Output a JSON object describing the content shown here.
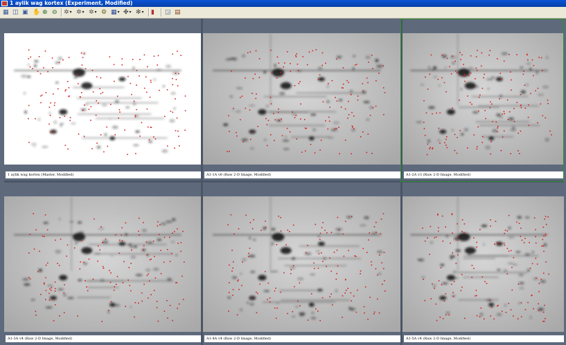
{
  "window": {
    "title": "1 aylik wag kortex (Experiment, Modified)"
  },
  "toolbar": {
    "buttons": [
      {
        "name": "grid-view-icon",
        "glyph": "▦"
      },
      {
        "name": "tile-view-icon",
        "glyph": "◫"
      },
      {
        "name": "image-view-icon",
        "glyph": "▣"
      },
      {
        "name": "pan-hand-icon",
        "glyph": "✋"
      },
      {
        "name": "zoom-in-icon",
        "glyph": "⊕"
      },
      {
        "name": "zoom-out-icon",
        "glyph": "⊖"
      },
      {
        "name": "spot-tool-icon",
        "glyph": "✲"
      },
      {
        "name": "spot-edit-icon",
        "glyph": "✲"
      },
      {
        "name": "spot-filter-icon",
        "glyph": "✲"
      },
      {
        "name": "match-tool-icon",
        "glyph": "⚙"
      },
      {
        "name": "grid-tool-icon",
        "glyph": "▦"
      },
      {
        "name": "landmark-tool-icon",
        "glyph": "✤"
      },
      {
        "name": "pattern-tool-icon",
        "glyph": "✻"
      },
      {
        "name": "color-bars-icon",
        "glyph": "▮"
      },
      {
        "name": "chart-icon",
        "glyph": "◲"
      },
      {
        "name": "properties-icon",
        "glyph": "▤"
      }
    ]
  },
  "panes": [
    {
      "label": "1 aylik wag kortex (Master, Modified)",
      "type": "master"
    },
    {
      "label": "A1-1A v6 (Raw 2-D Image, Modified)",
      "type": "raw"
    },
    {
      "label": "A1-2A v3 (Raw 2-D Image, Modified)",
      "type": "raw"
    },
    {
      "label": "A1-3A v4 (Raw 2-D Image, Modified)",
      "type": "raw"
    },
    {
      "label": "A1-4A v4 (Raw 2-D Image, Modified)",
      "type": "raw"
    },
    {
      "label": "A1-5A v4 (Raw 2-D Image, Modified)",
      "type": "raw"
    }
  ],
  "colors": {
    "titlebar": "#0a54d6",
    "workspace": "#5e6a7c",
    "spot_marker": "#d42020",
    "selection": "#2d8f2d"
  }
}
